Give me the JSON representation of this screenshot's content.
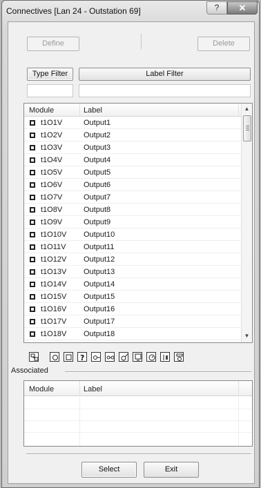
{
  "window": {
    "title": "Connectives [Lan 24 - Outstation 69]",
    "help_label": "?",
    "close_label": "✕"
  },
  "top_buttons": {
    "define": "Define",
    "delete": "Delete"
  },
  "filters": {
    "type_filter_label": "Type Filter",
    "label_filter_label": "Label Filter",
    "type_filter_value": "",
    "label_filter_value": ""
  },
  "connectives_table": {
    "columns": [
      "Module",
      "Label"
    ],
    "rows": [
      {
        "module": "t1O1V",
        "label": "Output1"
      },
      {
        "module": "t1O2V",
        "label": "Output2"
      },
      {
        "module": "t1O3V",
        "label": "Output3"
      },
      {
        "module": "t1O4V",
        "label": "Output4"
      },
      {
        "module": "t1O5V",
        "label": "Output5"
      },
      {
        "module": "t1O6V",
        "label": "Output6"
      },
      {
        "module": "t1O7V",
        "label": "Output7"
      },
      {
        "module": "t1O8V",
        "label": "Output8"
      },
      {
        "module": "t1O9V",
        "label": "Output9"
      },
      {
        "module": "t1O10V",
        "label": "Output10"
      },
      {
        "module": "t1O11V",
        "label": "Output11"
      },
      {
        "module": "t1O12V",
        "label": "Output12"
      },
      {
        "module": "t1O13V",
        "label": "Output13"
      },
      {
        "module": "t1O14V",
        "label": "Output14"
      },
      {
        "module": "t1O15V",
        "label": "Output15"
      },
      {
        "module": "t1O16V",
        "label": "Output16"
      },
      {
        "module": "t1O17V",
        "label": "Output17"
      },
      {
        "module": "t1O18V",
        "label": "Output18"
      }
    ]
  },
  "toolbar_icons": [
    "module-types-icon",
    "input-icon",
    "output-icon",
    "help-unknown-icon",
    "connector-icon",
    "double-connector-icon",
    "sensor-icon",
    "display-icon",
    "timer-icon",
    "schedule-icon",
    "logic-icon"
  ],
  "associated": {
    "group_label": "Associated",
    "columns": [
      "Module",
      "Label"
    ]
  },
  "bottom_buttons": {
    "select": "Select",
    "exit": "Exit"
  }
}
